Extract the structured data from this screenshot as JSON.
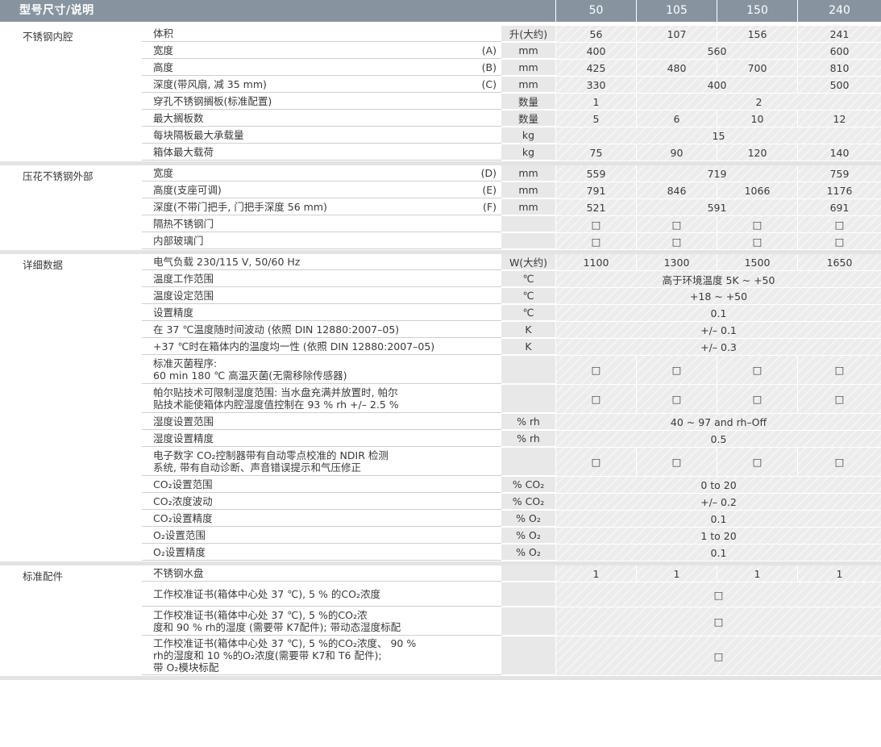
{
  "header": {
    "title": "型号尺寸/说明",
    "models": [
      "50",
      "105",
      "150",
      "240"
    ]
  },
  "sections": [
    {
      "name": "不锈钢内腔",
      "rows": [
        {
          "p": "体积",
          "ref": "",
          "unit": "升(大约)",
          "cells": [
            {
              "v": "56",
              "s": 1
            },
            {
              "v": "107",
              "s": 1
            },
            {
              "v": "156",
              "s": 1
            },
            {
              "v": "241",
              "s": 1
            }
          ]
        },
        {
          "p": "宽度",
          "ref": "(A)",
          "unit": "mm",
          "cells": [
            {
              "v": "400",
              "s": 1
            },
            {
              "v": "560",
              "s": 2
            },
            {
              "v": "600",
              "s": 1
            }
          ]
        },
        {
          "p": "高度",
          "ref": "(B)",
          "unit": "mm",
          "cells": [
            {
              "v": "425",
              "s": 1
            },
            {
              "v": "480",
              "s": 1
            },
            {
              "v": "700",
              "s": 1
            },
            {
              "v": "810",
              "s": 1
            }
          ]
        },
        {
          "p": "深度(带风扇, 减 35 mm)",
          "ref": "(C)",
          "unit": "mm",
          "cells": [
            {
              "v": "330",
              "s": 1
            },
            {
              "v": "400",
              "s": 2
            },
            {
              "v": "500",
              "s": 1
            }
          ]
        },
        {
          "p": "穿孔不锈钢搁板(标准配置)",
          "ref": "",
          "unit": "数量",
          "cells": [
            {
              "v": "1",
              "s": 1
            },
            {
              "v": "2",
              "s": 3
            }
          ]
        },
        {
          "p": "最大搁板数",
          "ref": "",
          "unit": "数量",
          "cells": [
            {
              "v": "5",
              "s": 1
            },
            {
              "v": "6",
              "s": 1
            },
            {
              "v": "10",
              "s": 1
            },
            {
              "v": "12",
              "s": 1
            }
          ]
        },
        {
          "p": "每块隔板最大承载量",
          "ref": "",
          "unit": "kg",
          "cells": [
            {
              "v": "15",
              "s": 4
            }
          ]
        },
        {
          "p": "箱体最大载荷",
          "ref": "",
          "unit": "kg",
          "cells": [
            {
              "v": "75",
              "s": 1
            },
            {
              "v": "90",
              "s": 1
            },
            {
              "v": "120",
              "s": 1
            },
            {
              "v": "140",
              "s": 1
            }
          ]
        }
      ]
    },
    {
      "name": "压花不锈钢外部",
      "rows": [
        {
          "p": "宽度",
          "ref": "(D)",
          "unit": "mm",
          "cells": [
            {
              "v": "559",
              "s": 1
            },
            {
              "v": "719",
              "s": 2
            },
            {
              "v": "759",
              "s": 1
            }
          ]
        },
        {
          "p": "高度(支座可调)",
          "ref": "(E)",
          "unit": "mm",
          "cells": [
            {
              "v": "791",
              "s": 1
            },
            {
              "v": "846",
              "s": 1
            },
            {
              "v": "1066",
              "s": 1
            },
            {
              "v": "1176",
              "s": 1
            }
          ]
        },
        {
          "p": "深度(不带门把手, 门把手深度 56 mm)",
          "ref": "(F)",
          "unit": "mm",
          "cells": [
            {
              "v": "521",
              "s": 1
            },
            {
              "v": "591",
              "s": 2
            },
            {
              "v": "691",
              "s": 1
            }
          ]
        },
        {
          "p": "隔热不锈钢门",
          "ref": "",
          "unit": "",
          "cells": [
            {
              "v": "□",
              "s": 1
            },
            {
              "v": "□",
              "s": 1
            },
            {
              "v": "□",
              "s": 1
            },
            {
              "v": "□",
              "s": 1
            }
          ]
        },
        {
          "p": "内部玻璃门",
          "ref": "",
          "unit": "",
          "cells": [
            {
              "v": "□",
              "s": 1
            },
            {
              "v": "□",
              "s": 1
            },
            {
              "v": "□",
              "s": 1
            },
            {
              "v": "□",
              "s": 1
            }
          ]
        }
      ]
    },
    {
      "name": "详细数据",
      "rows": [
        {
          "p": "电气负载 230/115 V, 50/60 Hz",
          "ref": "",
          "unit": "W(大约)",
          "cells": [
            {
              "v": "1100",
              "s": 1
            },
            {
              "v": "1300",
              "s": 1
            },
            {
              "v": "1500",
              "s": 1
            },
            {
              "v": "1650",
              "s": 1
            }
          ]
        },
        {
          "p": "温度工作范围",
          "ref": "",
          "unit": "℃",
          "cells": [
            {
              "v": "高于环境温度  5K ~ +50",
              "s": 4
            }
          ]
        },
        {
          "p": "温度设定范围",
          "ref": "",
          "unit": "℃",
          "cells": [
            {
              "v": "+18 ~ +50",
              "s": 4
            }
          ]
        },
        {
          "p": "设置精度",
          "ref": "",
          "unit": "℃",
          "cells": [
            {
              "v": "0.1",
              "s": 4
            }
          ]
        },
        {
          "p": "在 37 ℃温度随时间波动 (依照  DIN 12880:2007–05)",
          "ref": "",
          "unit": "K",
          "cells": [
            {
              "v": "+/– 0.1",
              "s": 4
            }
          ]
        },
        {
          "p": "+37 ℃时在箱体内的温度均一性 (依照  DIN 12880:2007–05)",
          "ref": "",
          "unit": "K",
          "cells": [
            {
              "v": "+/– 0.3",
              "s": 4
            }
          ]
        },
        {
          "p": "标准灭菌程序:\n60 min 180 ℃ 高温灭菌(无需移除传感器)",
          "ref": "",
          "unit": "",
          "cells": [
            {
              "v": "□",
              "s": 1
            },
            {
              "v": "□",
              "s": 1
            },
            {
              "v": "□",
              "s": 1
            },
            {
              "v": "□",
              "s": 1
            }
          ]
        },
        {
          "p": "帕尔贴技术可限制湿度范围: 当水盘充满并放置时, 帕尔\n贴技术能使箱体内腔湿度值控制在 93 % rh +/– 2.5 %",
          "ref": "",
          "unit": "",
          "cells": [
            {
              "v": "□",
              "s": 1
            },
            {
              "v": "□",
              "s": 1
            },
            {
              "v": "□",
              "s": 1
            },
            {
              "v": "□",
              "s": 1
            }
          ]
        },
        {
          "p": "湿度设置范围",
          "ref": "",
          "unit": "% rh",
          "cells": [
            {
              "v": "40 ~ 97 and rh–Off",
              "s": 4
            }
          ]
        },
        {
          "p": "湿度设置精度",
          "ref": "",
          "unit": "% rh",
          "cells": [
            {
              "v": "0.5",
              "s": 4
            }
          ]
        },
        {
          "p": "电子数字 CO₂控制器带有自动零点校准的 NDIR 检测\n系统, 带有自动诊断、声音错误提示和气压修正",
          "ref": "",
          "unit": "",
          "cells": [
            {
              "v": "□",
              "s": 1
            },
            {
              "v": "□",
              "s": 1
            },
            {
              "v": "□",
              "s": 1
            },
            {
              "v": "□",
              "s": 1
            }
          ]
        },
        {
          "p": "CO₂设置范围",
          "ref": "",
          "unit": "% CO₂",
          "cells": [
            {
              "v": "0 to 20",
              "s": 4
            }
          ]
        },
        {
          "p": "CO₂浓度波动",
          "ref": "",
          "unit": "% CO₂",
          "cells": [
            {
              "v": "+/– 0.2",
              "s": 4
            }
          ]
        },
        {
          "p": "CO₂设置精度",
          "ref": "",
          "unit": "% O₂",
          "cells": [
            {
              "v": "0.1",
              "s": 4
            }
          ]
        },
        {
          "p": "O₂设置范围",
          "ref": "",
          "unit": "% O₂",
          "cells": [
            {
              "v": "1 to 20",
              "s": 4
            }
          ]
        },
        {
          "p": "O₂设置精度",
          "ref": "",
          "unit": "% O₂",
          "cells": [
            {
              "v": "0.1",
              "s": 4
            }
          ]
        }
      ]
    },
    {
      "name": "标准配件",
      "rows": [
        {
          "p": "不锈钢水盘",
          "ref": "",
          "unit": "",
          "cells": [
            {
              "v": "1",
              "s": 1
            },
            {
              "v": "1",
              "s": 1
            },
            {
              "v": "1",
              "s": 1
            },
            {
              "v": "1",
              "s": 1
            }
          ]
        },
        {
          "p": "工作校准证书(箱体中心处 37 ℃), 5 % 的CO₂浓度",
          "ref": "",
          "unit": "",
          "cells": [
            {
              "v": "□",
              "s": 4
            }
          ]
        },
        {
          "p": "工作校准证书(箱体中心处 37 ℃), 5 %的CO₂浓\n度和 90 % rh的湿度 (需要带 K7配件); 带动态湿度标配",
          "ref": "",
          "unit": "",
          "cells": [
            {
              "v": "□",
              "s": 4
            }
          ]
        },
        {
          "p": "工作校准证书(箱体中心处 37 ℃), 5 %的CO₂浓度、 90 %\nrh的湿度和 10 %的O₂浓度(需要带 K7和 T6 配件);\n带 O₂模块标配",
          "ref": "",
          "unit": "",
          "cells": [
            {
              "v": "□",
              "s": 4
            }
          ]
        }
      ]
    }
  ]
}
